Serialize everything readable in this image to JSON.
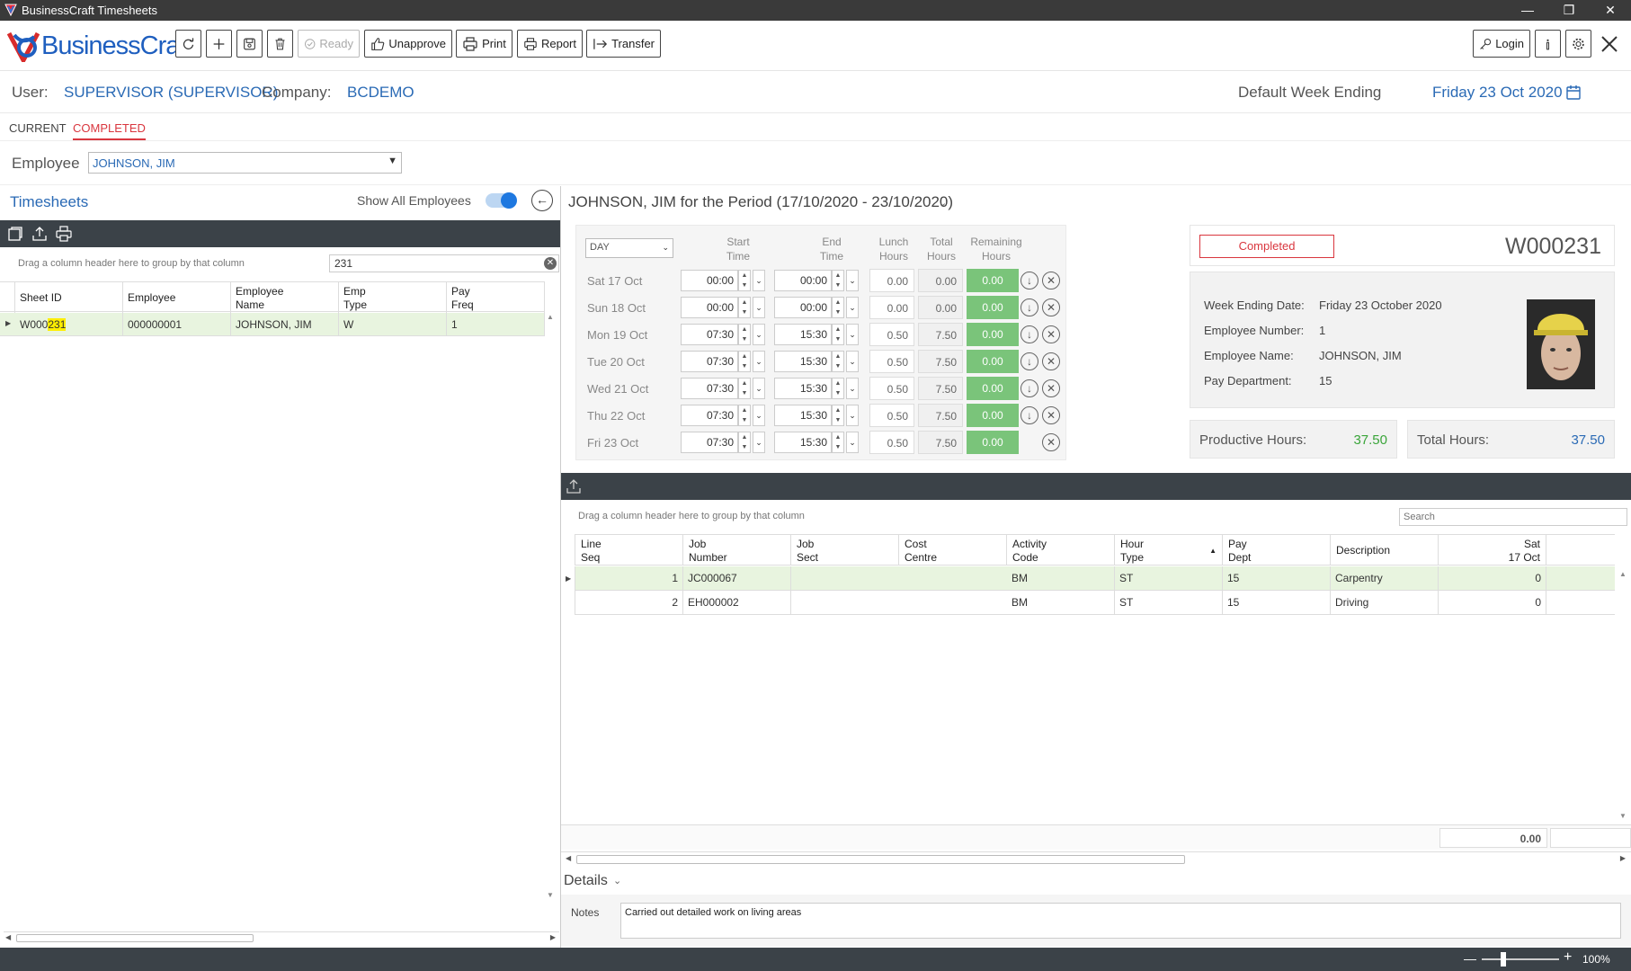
{
  "window": {
    "title": "BusinessCraft Timesheets"
  },
  "brand": {
    "name": "BusinessCraft"
  },
  "toolbar": {
    "ready_label": "Ready",
    "unapprove_label": "Unapprove",
    "print_label": "Print",
    "report_label": "Report",
    "transfer_label": "Transfer",
    "login_label": "Login"
  },
  "user": {
    "user_label": "User:",
    "user_value": "SUPERVISOR (SUPERVISOR)",
    "company_label": "Company:",
    "company_value": "BCDEMO",
    "week_ending_label": "Default Week Ending",
    "week_ending_value": "Friday 23 Oct 2020"
  },
  "tabs": [
    {
      "label": "CURRENT"
    },
    {
      "label": "COMPLETED"
    }
  ],
  "employee": {
    "label": "Employee",
    "value": "JOHNSON, JIM"
  },
  "timesheets": {
    "title": "Timesheets",
    "show_all_label": "Show All Employees",
    "group_hint": "Drag a column header here to group by that column",
    "search_value": "231",
    "columns": [
      {
        "line1": "Sheet ID",
        "line2": ""
      },
      {
        "line1": "Employee",
        "line2": ""
      },
      {
        "line1": "Employee",
        "line2": "Name"
      },
      {
        "line1": "Emp",
        "line2": "Type"
      },
      {
        "line1": "Pay",
        "line2": "Freq"
      }
    ],
    "rows": [
      {
        "sheet_prefix": "W000",
        "sheet_match": "231",
        "employee": "000000001",
        "name": "JOHNSON, JIM",
        "emp_type": "W",
        "pay_freq": "1"
      }
    ]
  },
  "period": {
    "title": "JOHNSON, JIM for the Period (17/10/2020 - 23/10/2020)",
    "mode": "DAY",
    "headers": {
      "start": [
        "Start",
        "Time"
      ],
      "end": [
        "End",
        "Time"
      ],
      "lunch": [
        "Lunch",
        "Hours"
      ],
      "total": [
        "Total",
        "Hours"
      ],
      "remaining": [
        "Remaining",
        "Hours"
      ]
    },
    "days": [
      {
        "label": "Sat 17 Oct",
        "start": "00:00",
        "end": "00:00",
        "lunch": "0.00",
        "total": "0.00",
        "remaining": "0.00"
      },
      {
        "label": "Sun 18 Oct",
        "start": "00:00",
        "end": "00:00",
        "lunch": "0.00",
        "total": "0.00",
        "remaining": "0.00"
      },
      {
        "label": "Mon 19 Oct",
        "start": "07:30",
        "end": "15:30",
        "lunch": "0.50",
        "total": "7.50",
        "remaining": "0.00"
      },
      {
        "label": "Tue 20 Oct",
        "start": "07:30",
        "end": "15:30",
        "lunch": "0.50",
        "total": "7.50",
        "remaining": "0.00"
      },
      {
        "label": "Wed 21 Oct",
        "start": "07:30",
        "end": "15:30",
        "lunch": "0.50",
        "total": "7.50",
        "remaining": "0.00"
      },
      {
        "label": "Thu 22 Oct",
        "start": "07:30",
        "end": "15:30",
        "lunch": "0.50",
        "total": "7.50",
        "remaining": "0.00"
      },
      {
        "label": "Fri 23 Oct",
        "start": "07:30",
        "end": "15:30",
        "lunch": "0.50",
        "total": "7.50",
        "remaining": "0.00"
      }
    ]
  },
  "summary": {
    "status": "Completed",
    "sheet_id": "W000231",
    "week_ending_label": "Week Ending Date:",
    "week_ending_value": "Friday 23 October 2020",
    "emp_number_label": "Employee Number:",
    "emp_number_value": "1",
    "emp_name_label": "Employee Name:",
    "emp_name_value": "JOHNSON, JIM",
    "pay_dept_label": "Pay Department:",
    "pay_dept_value": "15",
    "productive_label": "Productive Hours:",
    "productive_value": "37.50",
    "total_label": "Total Hours:",
    "total_value": "37.50"
  },
  "lines": {
    "group_hint": "Drag a column header here to group by that column",
    "search_placeholder": "Search",
    "columns": [
      {
        "line1": "Line",
        "line2": "Seq"
      },
      {
        "line1": "Job",
        "line2": "Number"
      },
      {
        "line1": "Job",
        "line2": "Sect"
      },
      {
        "line1": "Cost",
        "line2": "Centre"
      },
      {
        "line1": "Activity",
        "line2": "Code"
      },
      {
        "line1": "Hour",
        "line2": "Type"
      },
      {
        "line1": "Pay",
        "line2": "Dept"
      },
      {
        "line1": "Description",
        "line2": ""
      },
      {
        "line1": "Sat",
        "line2": "17 Oct"
      }
    ],
    "rows": [
      {
        "seq": "1",
        "job": "JC000067",
        "sect": "",
        "cost": "",
        "activity": "BM",
        "hour_type": "ST",
        "pay_dept": "15",
        "desc": "Carpentry",
        "sat": "0"
      },
      {
        "seq": "2",
        "job": "EH000002",
        "sect": "",
        "cost": "",
        "activity": "BM",
        "hour_type": "ST",
        "pay_dept": "15",
        "desc": "Driving",
        "sat": "0"
      }
    ],
    "footer_total": "0.00"
  },
  "details": {
    "title": "Details",
    "notes_label": "Notes",
    "notes_value": "Carried out detailed work on living areas"
  },
  "statusbar": {
    "zoom": "100%"
  },
  "colors": {
    "accent": "#2a6ab5",
    "green": "#7ac47a",
    "dark": "#3b4248",
    "status_red": "#d9363e"
  }
}
